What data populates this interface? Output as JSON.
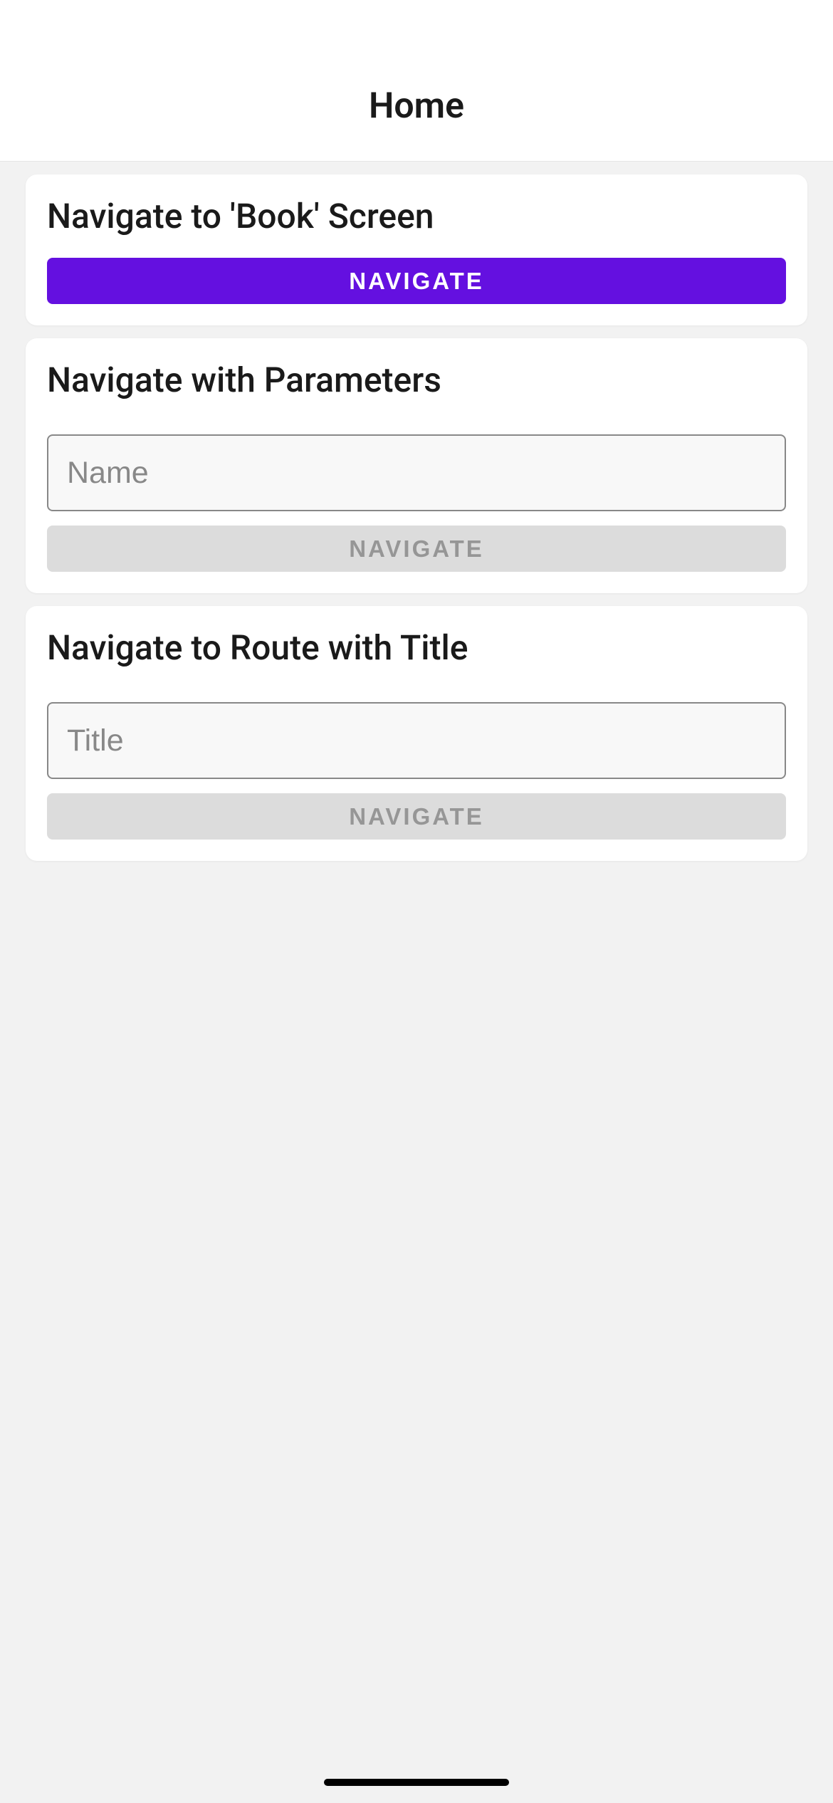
{
  "header": {
    "title": "Home"
  },
  "cards": {
    "book": {
      "title": "Navigate to 'Book' Screen",
      "button_label": "NAVIGATE"
    },
    "params": {
      "title": "Navigate with Parameters",
      "input_placeholder": "Name",
      "input_value": "",
      "button_label": "NAVIGATE"
    },
    "route": {
      "title": "Navigate to Route with Title",
      "input_placeholder": "Title",
      "input_value": "",
      "button_label": "NAVIGATE"
    }
  }
}
